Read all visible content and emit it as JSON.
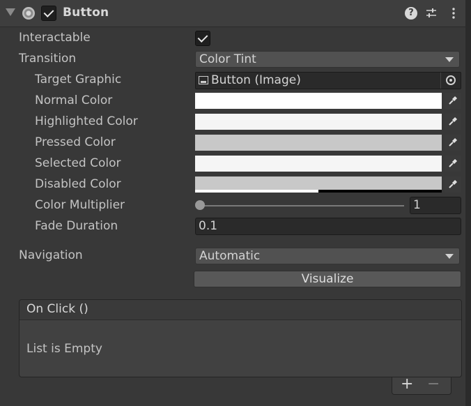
{
  "component": {
    "title": "Button",
    "enabled": true,
    "icons": {
      "foldout": "foldout-arrow-icon",
      "component": "button-component-icon",
      "help": "help-icon",
      "settings": "settings-sliders-icon",
      "more": "kebab-menu-icon"
    },
    "help_symbol": "?",
    "settings_symbol": "☷",
    "more_symbol": "⋮"
  },
  "fields": {
    "interactable": {
      "label": "Interactable",
      "value": true
    },
    "transition": {
      "label": "Transition",
      "value": "Color Tint"
    },
    "target_graphic": {
      "label": "Target Graphic",
      "value": "Button (Image)",
      "icon": "image-object-icon",
      "picker_icon": "object-picker-icon"
    },
    "normal_color": {
      "label": "Normal Color",
      "color": "#FFFFFF"
    },
    "highlighted_color": {
      "label": "Highlighted Color",
      "color": "#F5F5F5"
    },
    "pressed_color": {
      "label": "Pressed Color",
      "color": "#C8C8C8"
    },
    "selected_color": {
      "label": "Selected Color",
      "color": "#F5F5F5"
    },
    "disabled_color": {
      "label": "Disabled Color",
      "color": "#C8C8C8",
      "alpha": 0.5
    },
    "color_multiplier": {
      "label": "Color Multiplier",
      "value": "1",
      "slider_value": 1,
      "slider_min": 1,
      "slider_max": 5
    },
    "fade_duration": {
      "label": "Fade Duration",
      "value": "0.1"
    },
    "navigation": {
      "label": "Navigation",
      "value": "Automatic"
    },
    "visualize": {
      "label": "Visualize"
    }
  },
  "events": {
    "on_click": {
      "title": "On Click ()",
      "empty_text": "List is Empty",
      "add_symbol": "+",
      "remove_symbol": "−"
    }
  },
  "colors": {
    "panel": "#383838",
    "header": "#3E3E3E",
    "field_dark": "#2A2A2A",
    "dropdown": "#515151",
    "button": "#585858",
    "text": "#C4C4C4"
  }
}
